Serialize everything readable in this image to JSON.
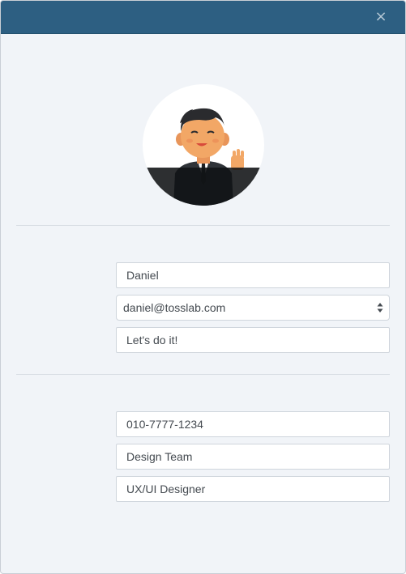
{
  "header": {
    "close_glyph": "×"
  },
  "profile": {
    "name": "Daniel",
    "email": "daniel@tosslab.com",
    "status_message": "Let's do it!"
  },
  "details": {
    "phone": "010-7777-1234",
    "department": "Design Team",
    "position": "UX/UI Designer"
  },
  "colors": {
    "header": "#2d5f82",
    "background": "#f1f4f8"
  },
  "icons": [
    "close-icon",
    "select-arrows-icon"
  ]
}
